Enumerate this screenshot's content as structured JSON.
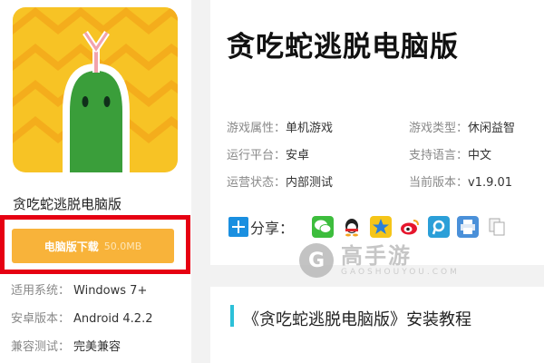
{
  "app": {
    "name": "贪吃蛇逃脱电脑版",
    "icon": "snake-game-icon",
    "download_button": {
      "label": "电脑版下载",
      "size": "50.0MB"
    },
    "specs": [
      {
        "key": "适用系统：",
        "value": "Windows 7+"
      },
      {
        "key": "安卓版本：",
        "value": "Android 4.2.2"
      },
      {
        "key": "兼容测试：",
        "value": "完美兼容"
      }
    ]
  },
  "info": {
    "title": "贪吃蛇逃脱电脑版",
    "attrs": [
      {
        "key": "游戏属性：",
        "value": "单机游戏"
      },
      {
        "key": "游戏类型：",
        "value": "休闲益智"
      },
      {
        "key": "运行平台：",
        "value": "安卓"
      },
      {
        "key": "支持语言：",
        "value": "中文"
      },
      {
        "key": "运营状态：",
        "value": "内部测试"
      },
      {
        "key": "当前版本：",
        "value": "v1.9.01"
      }
    ],
    "share_label": "分享：",
    "share_icons": [
      "wechat-icon",
      "qq-icon",
      "qzone-icon",
      "weibo-icon",
      "tencent-weibo-icon",
      "print-icon",
      "copy-icon"
    ]
  },
  "tutorial": {
    "title": "《贪吃蛇逃脱电脑版》安装教程"
  },
  "watermark": {
    "logo_letter": "G",
    "text_cn": "高手游",
    "text_en": "GAOSHOUYOU.COM"
  },
  "colors": {
    "download_button": "#f8b33a",
    "highlight_frame": "#e60012",
    "tutorial_accent": "#2cc0d8",
    "share_accent": "#1a8fe0"
  }
}
